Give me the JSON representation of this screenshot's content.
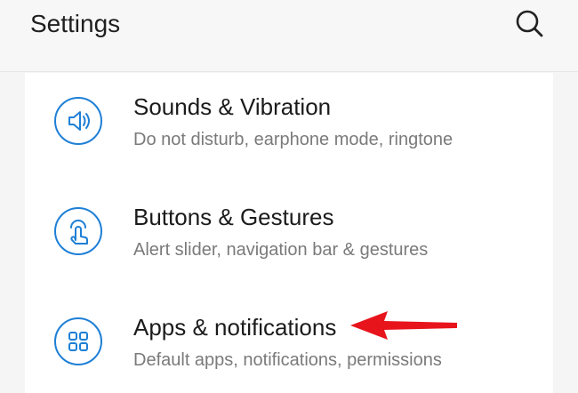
{
  "header": {
    "title": "Settings",
    "search_icon": "search-icon"
  },
  "rows": [
    {
      "title": "Sounds & Vibration",
      "subtitle": "Do not disturb, earphone mode, ringtone",
      "icon": "speaker-icon"
    },
    {
      "title": "Buttons & Gestures",
      "subtitle": "Alert slider, navigation bar & gestures",
      "icon": "touch-gesture-icon"
    },
    {
      "title": "Apps & notifications",
      "subtitle": "Default apps, notifications, permissions",
      "icon": "apps-grid-icon"
    }
  ],
  "colors": {
    "accent": "#1e7fd6",
    "annotation_arrow": "#e8141b",
    "title_text": "#1b1b1b",
    "subtitle_text": "#7a7a7a"
  }
}
